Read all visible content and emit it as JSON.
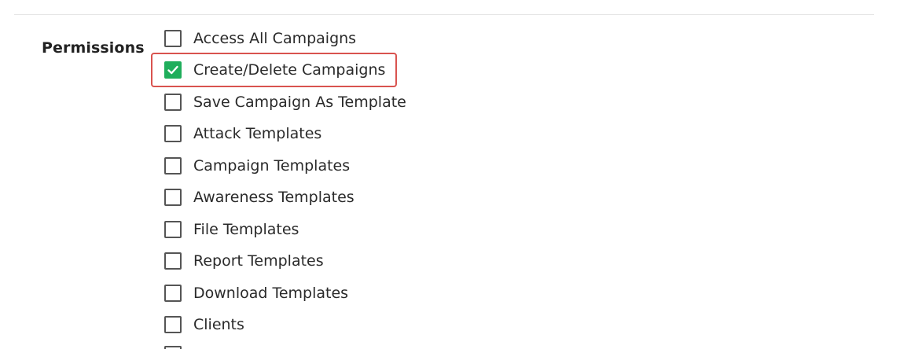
{
  "permissions": {
    "label": "Permissions",
    "items": [
      {
        "label": "Access All Campaigns",
        "checked": false
      },
      {
        "label": "Create/Delete Campaigns",
        "checked": true,
        "highlighted": true
      },
      {
        "label": "Save Campaign As Template",
        "checked": false
      },
      {
        "label": "Attack Templates",
        "checked": false
      },
      {
        "label": "Campaign Templates",
        "checked": false
      },
      {
        "label": "Awareness Templates",
        "checked": false
      },
      {
        "label": "File Templates",
        "checked": false
      },
      {
        "label": "Report Templates",
        "checked": false
      },
      {
        "label": "Download Templates",
        "checked": false
      },
      {
        "label": "Clients",
        "checked": false
      }
    ]
  },
  "colors": {
    "checked": "#1fae5b",
    "highlight_border": "#d9534f",
    "unchecked_border": "#555555"
  }
}
